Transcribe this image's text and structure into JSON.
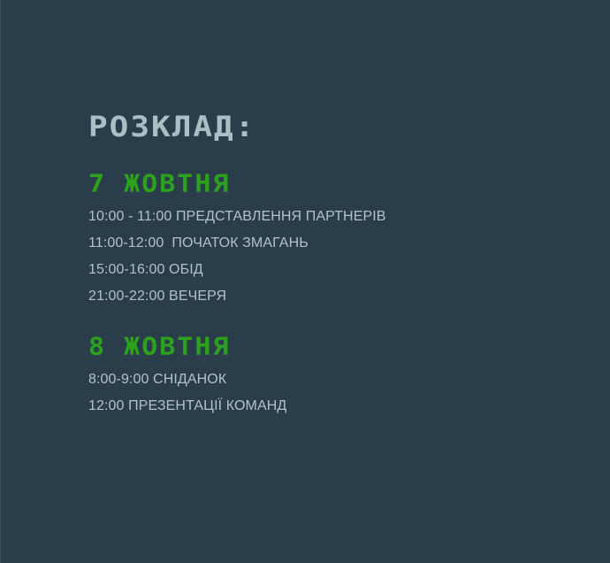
{
  "title": "РОЗКЛАД:",
  "days": [
    {
      "heading": "7 ЖОВТНЯ",
      "items": [
        "10:00 - 11:00 ПРЕДСТАВЛЕННЯ ПАРТНЕРІВ",
        "11:00-12:00  ПОЧАТОК ЗМАГАНЬ",
        "15:00-16:00 ОБІД",
        "21:00-22:00 ВЕЧЕРЯ"
      ]
    },
    {
      "heading": "8 ЖОВТНЯ",
      "items": [
        "8:00-9:00 СНІДАНОК",
        "12:00 ПРЕЗЕНТАЦІЇ КОМАНД"
      ]
    }
  ],
  "colors": {
    "background": "#293d4b",
    "title": "#a8c0c3",
    "day_heading": "#2ea11c",
    "item_text": "#b3c2c8"
  }
}
